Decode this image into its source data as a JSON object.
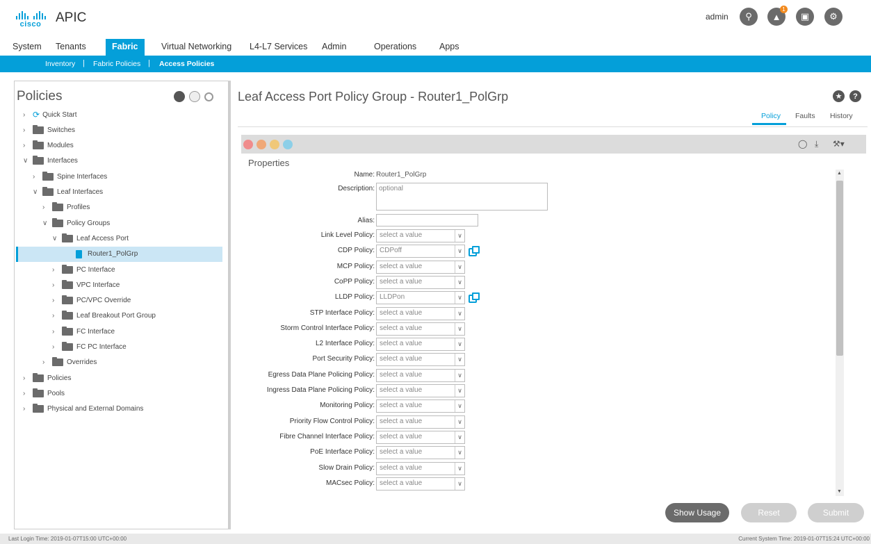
{
  "header": {
    "logo_text": "cisco",
    "app_title": "APIC",
    "user": "admin",
    "notification_count": "1",
    "icons": [
      "search-icon",
      "bell-icon",
      "monitor-icon",
      "gear-icon"
    ]
  },
  "main_nav": {
    "tabs": [
      "System",
      "Tenants",
      "Fabric",
      "Virtual Networking",
      "L4-L7 Services",
      "Admin",
      "Operations",
      "Apps"
    ],
    "active": "Fabric"
  },
  "sub_nav": {
    "items": [
      "Inventory",
      "Fabric Policies",
      "Access Policies"
    ],
    "separator": "|",
    "active": "Access Policies"
  },
  "left_panel": {
    "title": "Policies",
    "tree": [
      {
        "label": "Quick Start",
        "level": 0,
        "icon": "quick-start-icon"
      },
      {
        "label": "Switches",
        "level": 0,
        "icon": "folder-icon"
      },
      {
        "label": "Modules",
        "level": 0,
        "icon": "folder-icon"
      },
      {
        "label": "Interfaces",
        "level": 0,
        "icon": "folder-icon",
        "expanded": true
      },
      {
        "label": "Spine Interfaces",
        "level": 1,
        "icon": "folder-icon"
      },
      {
        "label": "Leaf Interfaces",
        "level": 1,
        "icon": "folder-icon",
        "expanded": true
      },
      {
        "label": "Profiles",
        "level": 2,
        "icon": "folder-icon"
      },
      {
        "label": "Policy Groups",
        "level": 2,
        "icon": "folder-icon",
        "expanded": true
      },
      {
        "label": "Leaf Access Port",
        "level": 3,
        "icon": "folder-icon",
        "expanded": true
      },
      {
        "label": "Router1_PolGrp",
        "level": 4,
        "icon": "document-icon",
        "selected": true
      },
      {
        "label": "PC Interface",
        "level": 3,
        "icon": "folder-icon"
      },
      {
        "label": "VPC Interface",
        "level": 3,
        "icon": "folder-icon"
      },
      {
        "label": "PC/VPC Override",
        "level": 3,
        "icon": "folder-icon"
      },
      {
        "label": "Leaf Breakout Port Group",
        "level": 3,
        "icon": "folder-icon"
      },
      {
        "label": "FC Interface",
        "level": 3,
        "icon": "folder-icon"
      },
      {
        "label": "FC PC Interface",
        "level": 3,
        "icon": "folder-icon"
      },
      {
        "label": "Overrides",
        "level": 2,
        "icon": "folder-icon"
      },
      {
        "label": "Policies",
        "level": 0,
        "icon": "folder-icon"
      },
      {
        "label": "Pools",
        "level": 0,
        "icon": "folder-icon"
      },
      {
        "label": "Physical and External Domains",
        "level": 0,
        "icon": "folder-icon"
      }
    ]
  },
  "right_panel": {
    "title": "Leaf Access Port Policy Group - Router1_PolGrp",
    "tabs": [
      "Policy",
      "Faults",
      "History"
    ],
    "active_tab": "Policy",
    "properties_title": "Properties",
    "name_label": "Name:",
    "name_value": "Router1_PolGrp",
    "description_label": "Description:",
    "description_placeholder": "optional",
    "alias_label": "Alias:",
    "alias_value": "",
    "policies": [
      {
        "label": "Link Level Policy:",
        "value": "select a value",
        "ext": false
      },
      {
        "label": "CDP Policy:",
        "value": "CDPoff",
        "ext": true
      },
      {
        "label": "MCP Policy:",
        "value": "select a value",
        "ext": false
      },
      {
        "label": "CoPP Policy:",
        "value": "select a value",
        "ext": false
      },
      {
        "label": "LLDP Policy:",
        "value": "LLDPon",
        "ext": true
      },
      {
        "label": "STP Interface Policy:",
        "value": "select a value",
        "ext": false
      },
      {
        "label": "Storm Control Interface Policy:",
        "value": "select a value",
        "ext": false
      },
      {
        "label": "L2 Interface Policy:",
        "value": "select a value",
        "ext": false
      },
      {
        "label": "Port Security Policy:",
        "value": "select a value",
        "ext": false
      },
      {
        "label": "Egress Data Plane Policing Policy:",
        "value": "select a value",
        "ext": false
      },
      {
        "label": "Ingress Data Plane Policing Policy:",
        "value": "select a value",
        "ext": false
      },
      {
        "label": "Monitoring Policy:",
        "value": "select a value",
        "ext": false
      },
      {
        "label": "Priority Flow Control Policy:",
        "value": "select a value",
        "ext": false
      },
      {
        "label": "Fibre Channel Interface Policy:",
        "value": "select a value",
        "ext": false
      },
      {
        "label": "PoE Interface Policy:",
        "value": "select a value",
        "ext": false
      },
      {
        "label": "Slow Drain Policy:",
        "value": "select a value",
        "ext": false
      },
      {
        "label": "MACsec Policy:",
        "value": "select a value",
        "ext": false
      }
    ],
    "buttons": {
      "show_usage": "Show Usage",
      "reset": "Reset",
      "submit": "Submit"
    },
    "fault_colors": [
      "#f08c8c",
      "#f0a878",
      "#f0c878",
      "#8ccfe8"
    ]
  },
  "status_bar": {
    "last_login": "Last Login Time: 2019-01-07T15:00 UTC+00:00",
    "current_time": "Current System Time: 2019-01-07T15:24 UTC+00:00"
  }
}
